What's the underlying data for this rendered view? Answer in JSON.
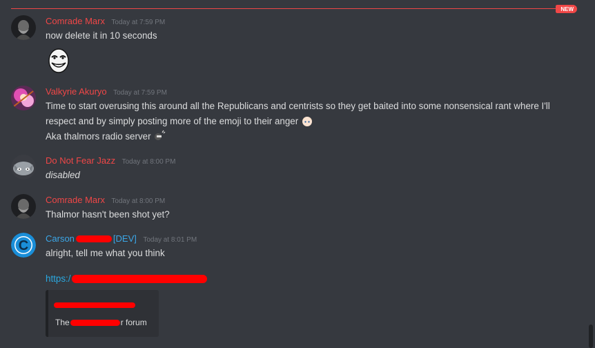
{
  "divider": {
    "badge": "NEW"
  },
  "messages": [
    {
      "author": "Comrade Marx",
      "time": "Today at 7:59 PM",
      "lines": [
        "now delete it in 10 seconds"
      ],
      "attachment": "trollface-emoji"
    },
    {
      "author": "Valkyrie Akuryo",
      "time": "Today at 7:59 PM",
      "lines": [
        "Time to start overusing this around all the Republicans and centrists so they get baited into some nonsensical rant where I'll",
        "respect and by simply posting more of the emoji to their anger",
        "Aka thalmors radio server"
      ]
    },
    {
      "author": "Do Not Fear Jazz",
      "time": "Today at 8:00 PM",
      "lines": [
        "disabled"
      ]
    },
    {
      "author": "Comrade Marx",
      "time": "Today at 8:00 PM",
      "lines": [
        "Thalmor hasn't been shot yet?"
      ]
    },
    {
      "author_first": "Carson",
      "author_tag": "[DEV]",
      "time": "Today at 8:01 PM",
      "lines": [
        "alright, tell me what you think"
      ],
      "link_prefix": "https:/",
      "embed": {
        "desc_start": "The",
        "desc_end": "r forum"
      }
    }
  ],
  "colors": {
    "background": "#36393f",
    "username_red": "#f04747",
    "username_blue": "#3ba7e8",
    "link": "#2aa8e0",
    "redaction": "#ff0000"
  }
}
